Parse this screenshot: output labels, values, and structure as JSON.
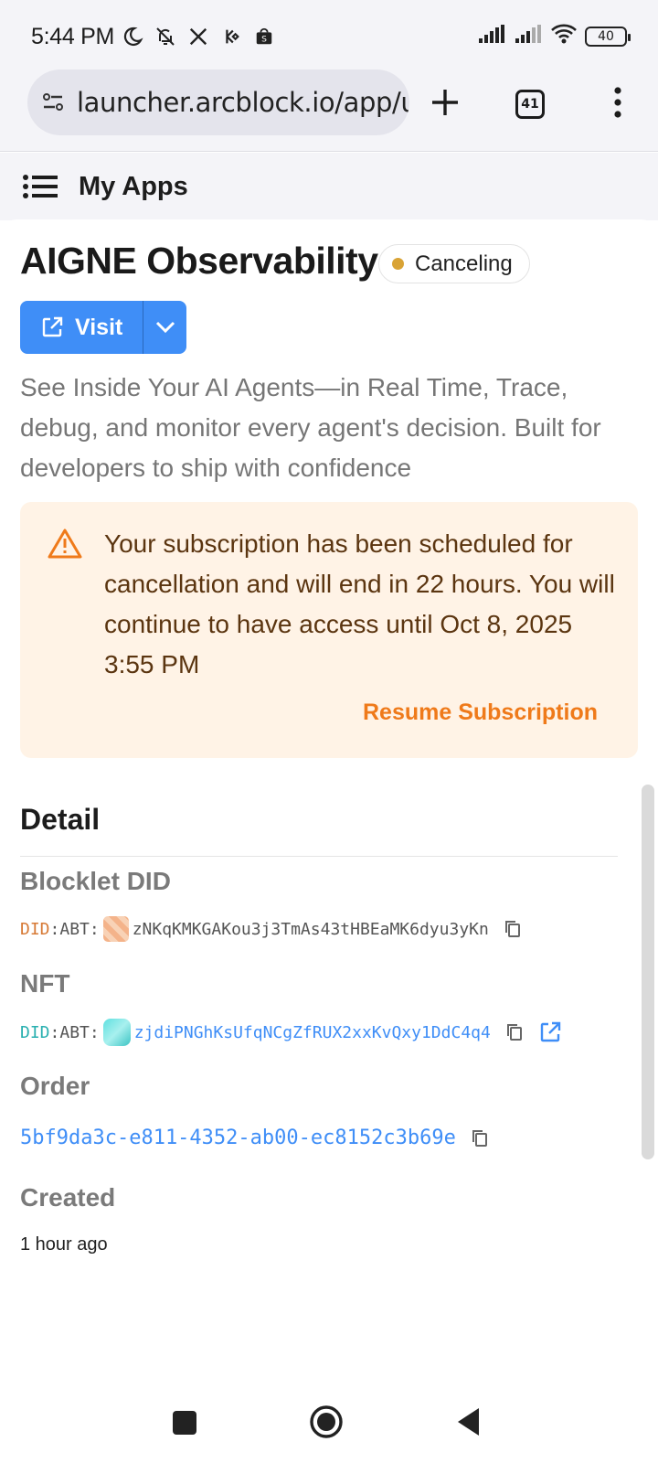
{
  "status_bar": {
    "time": "5:44 PM",
    "icons_left": [
      "moon-icon",
      "bell-off-icon",
      "x-app-icon",
      "kucoin-icon",
      "shop-bag-icon"
    ],
    "icons_right": [
      "cell-signal-icon",
      "cell-signal-icon",
      "wifi-icon"
    ],
    "battery": "40"
  },
  "browser": {
    "url": "launcher.arcblock.io/app/u",
    "tab_count": "41"
  },
  "appbar": {
    "title": "My Apps"
  },
  "app": {
    "title": "AIGNE Observability",
    "status": "Canceling",
    "status_color": "#d9a336",
    "visit_label": "Visit",
    "accent_color": "#3f8ef7",
    "description": "See Inside Your AI Agents—in Real Time, Trace, debug, and monitor every agent's decision. Built for developers to ship with confidence"
  },
  "alert": {
    "message": "Your subscription has been scheduled for cancellation and will end in 22 hours. You will continue to have access until Oct 8, 2025 3:55 PM",
    "action": "Resume Subscription"
  },
  "detail": {
    "title": "Detail",
    "blocklet_did": {
      "label": "Blocklet DID",
      "prefix_did": "DID",
      "prefix_abt": ":ABT:",
      "value": "zNKqKMKGAKou3j3TmAs43tHBEaMK6dyu3yKn"
    },
    "nft": {
      "label": "NFT",
      "prefix_did": "DID",
      "prefix_abt": ":ABT:",
      "value": "zjdiPNGhKsUfqNCgZfRUX2xxKvQxy1DdC4q4"
    },
    "order": {
      "label": "Order",
      "value": "5bf9da3c-e811-4352-ab00-ec8152c3b69e"
    },
    "created": {
      "label": "Created",
      "value": "1 hour ago"
    }
  }
}
